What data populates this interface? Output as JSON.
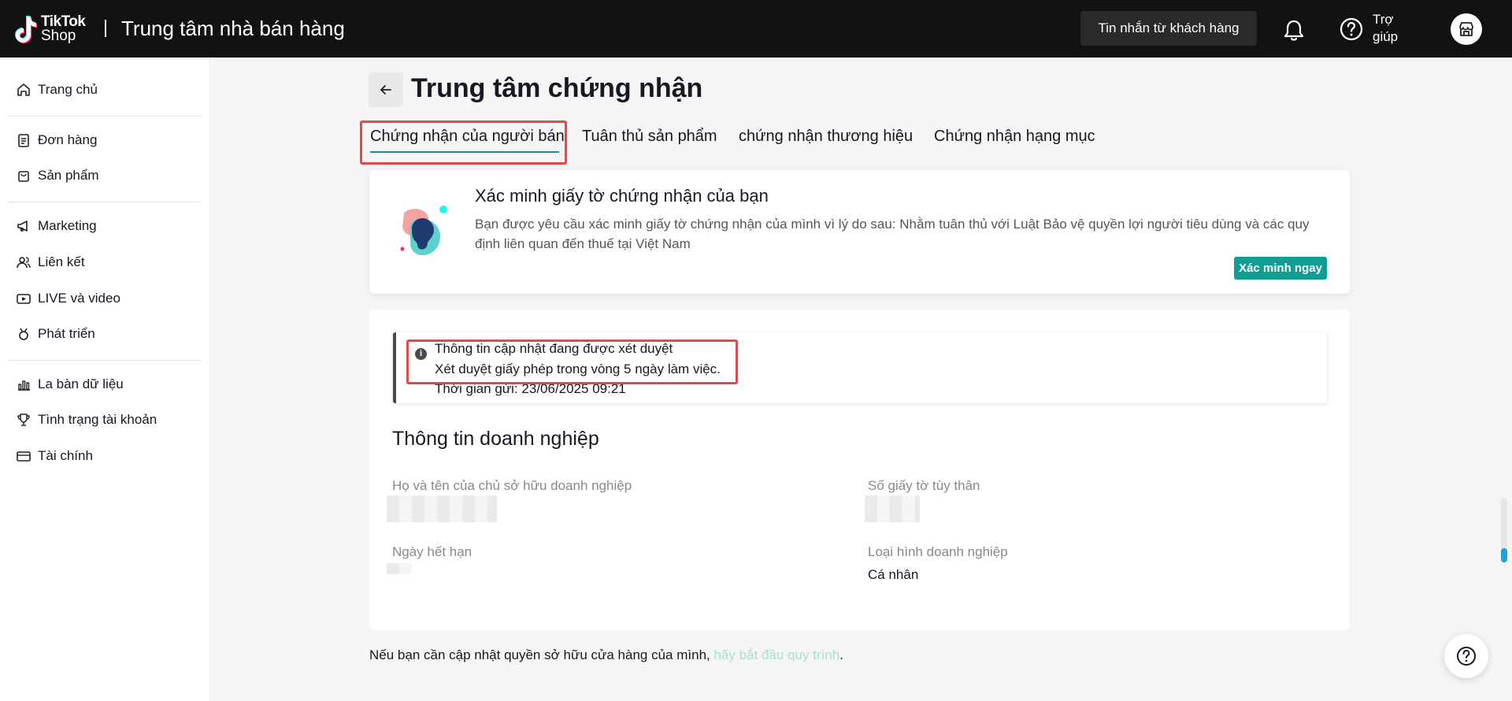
{
  "header": {
    "logo_line1": "TikTok",
    "logo_line2": "Shop",
    "title": "Trung tâm nhà bán hàng",
    "message_button": "Tin nhắn từ khách hàng",
    "help_line1": "Trợ",
    "help_line2": "giúp"
  },
  "sidebar": {
    "items": [
      {
        "label": "Trang chủ",
        "icon": "home-icon"
      },
      {
        "label": "Đơn hàng",
        "icon": "clipboard-icon"
      },
      {
        "label": "Sản phẩm",
        "icon": "bag-icon"
      },
      {
        "label": "Marketing",
        "icon": "megaphone-icon"
      },
      {
        "label": "Liên kết",
        "icon": "users-icon"
      },
      {
        "label": "LIVE và video",
        "icon": "video-icon"
      },
      {
        "label": "Phát triển",
        "icon": "medal-icon"
      },
      {
        "label": "La bàn dữ liệu",
        "icon": "chart-icon"
      },
      {
        "label": "Tình trạng tài khoản",
        "icon": "trophy-icon"
      },
      {
        "label": "Tài chính",
        "icon": "wallet-icon"
      }
    ]
  },
  "page": {
    "title": "Trung tâm chứng nhận",
    "tabs": [
      {
        "label": "Chứng nhận của người bán"
      },
      {
        "label": "Tuân thủ sản phẩm"
      },
      {
        "label": "chứng nhận thương hiệu"
      },
      {
        "label": "Chứng nhận hạng mục"
      }
    ],
    "active_tab": "Chứng nhận của người bán"
  },
  "verify": {
    "title": "Xác minh giấy tờ chứng nhận của bạn",
    "description": "Bạn được yêu cầu xác minh giấy tờ chứng nhận của mình vì lý do sau: Nhằm tuân thủ với Luật Bảo vệ quyền lợi người tiêu dùng và các quy định liên quan đến thuế tại Việt Nam",
    "button": "Xác minh ngay"
  },
  "notice": {
    "line1": "Thông tin cập nhật đang được xét duyệt",
    "line2": "Xét duyệt giấy phép trong vòng 5 ngày làm việc.",
    "line3": "Thời gian gửi: 23/06/2025 09:21"
  },
  "business": {
    "section_title": "Thông tin doanh nghiệp",
    "owner_label": "Họ và tên của chủ sở hữu doanh nghiệp",
    "id_label": "Số giấy tờ tùy thân",
    "expiry_label": "Ngày hết hạn",
    "type_label": "Loại hình doanh nghiệp",
    "type_value": "Cá nhân"
  },
  "footer": {
    "text": "Nếu bạn cần cập nhật quyền sở hữu cửa hàng của mình, ",
    "link": "hãy bắt đầu quy trình",
    "period": "."
  },
  "colors": {
    "accent": "#0f9e94",
    "highlight": "#e34949",
    "topbar": "#121212"
  }
}
